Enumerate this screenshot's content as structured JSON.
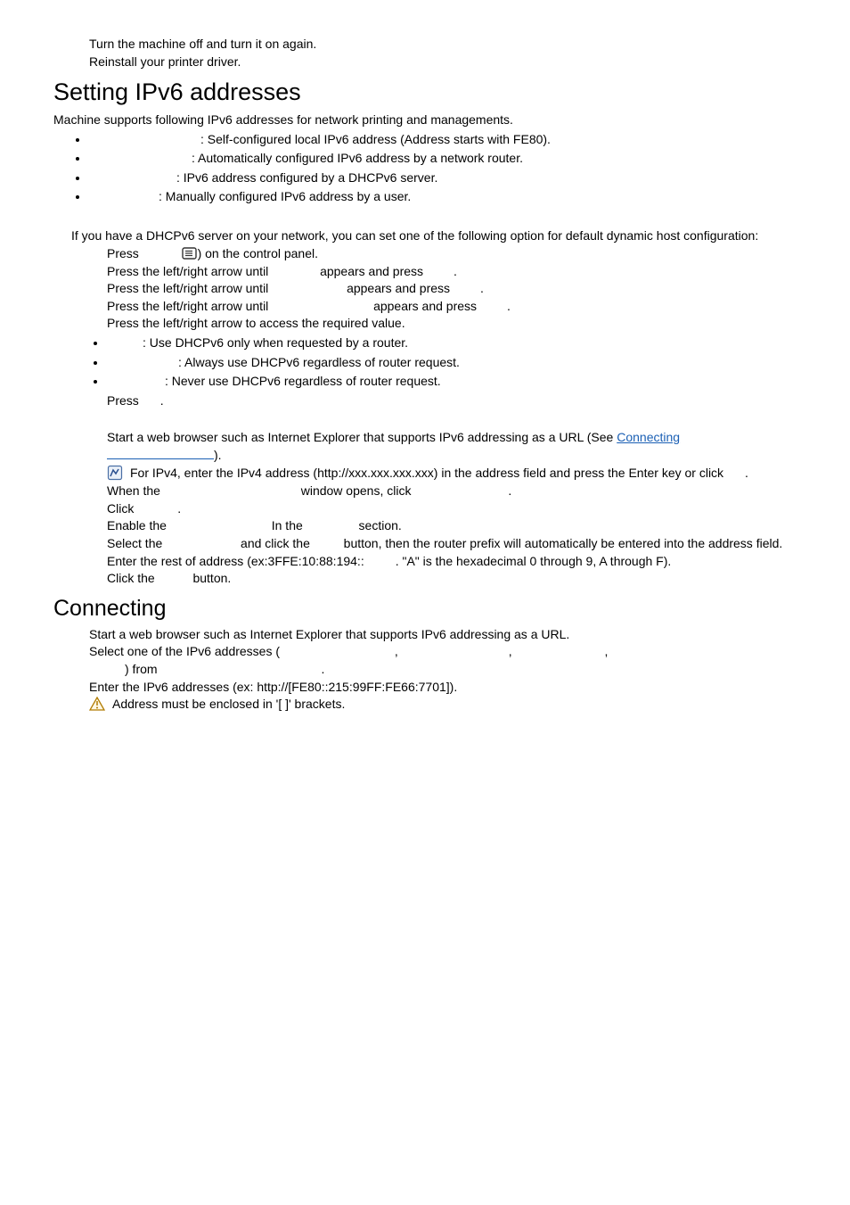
{
  "top": {
    "line1": "Turn the machine off and turn it on again.",
    "line2": "Reinstall your printer driver."
  },
  "sec1": {
    "title": "Setting IPv6 addresses",
    "intro": "Machine supports following IPv6 addresses for network printing and managements.",
    "li1": ": Self-configured local IPv6 address (Address starts with FE80).",
    "li2": ": Automatically configured IPv6 address by a network router.",
    "li3": ": IPv6 address configured by a DHCPv6 server.",
    "li4": ": Manually configured IPv6 address by a user."
  },
  "dhcp": {
    "intro": "If you have a DHCPv6 server on your network, you can set one of the following option for default dynamic host configuration:",
    "s1a": "Press ",
    "s1b": ") on the control panel.",
    "s2a": "Press the left/right arrow until ",
    "s2b": " appears and press ",
    "s2c": ".",
    "s3a": "Press the left/right arrow until ",
    "s3b": " appears and press ",
    "s3c": ".",
    "s4a": "Press the left/right arrow until ",
    "s4b": " appears and press ",
    "s4c": ".",
    "s5": "Press the left/right arrow to access the required value.",
    "li1": ": Use DHCPv6 only when requested by a router.",
    "li2": ": Always use DHCPv6 regardless of router request.",
    "li3": ": Never use DHCPv6 regardless of router request.",
    "s6a": "Press ",
    "s6b": "."
  },
  "sws": {
    "s1a": "Start a web browser such as Internet Explorer that supports IPv6 addressing as a URL (See ",
    "link1": "Connecting ",
    "s1b": ").",
    "note1a": "For IPv4, enter the IPv4 address (http://xxx.xxx.xxx.xxx) in the address field and press the Enter key or click ",
    "note1b": ".",
    "s2a": "When the ",
    "s2b": " window opens, click ",
    "s2c": ".",
    "s3a": "Click ",
    "s3b": ".",
    "s4a": "Enable the ",
    "s4b": " In the ",
    "s4c": " section.",
    "s5a": "Select the ",
    "s5b": " and click the ",
    "s5c": " button, then the router prefix will automatically be entered into the address field.",
    "s6a": "Enter the rest of address (ex:3FFE:10:88:194::",
    "s6b": ". \"A\" is the hexadecimal 0 through 9, A through F).",
    "s7a": "Click the ",
    "s7b": " button."
  },
  "conn": {
    "title": "Connecting ",
    "s1": "Start a web browser such as Internet Explorer that supports IPv6 addressing as a URL.",
    "s2a": "Select one of the IPv6 addresses (",
    "comma": ", ",
    "s2b": ") from ",
    "period": ".",
    "s3": "Enter the IPv6 addresses (ex: http://[FE80::215:99FF:FE66:7701]).",
    "warn": "Address must be enclosed in '[ ]' brackets."
  }
}
